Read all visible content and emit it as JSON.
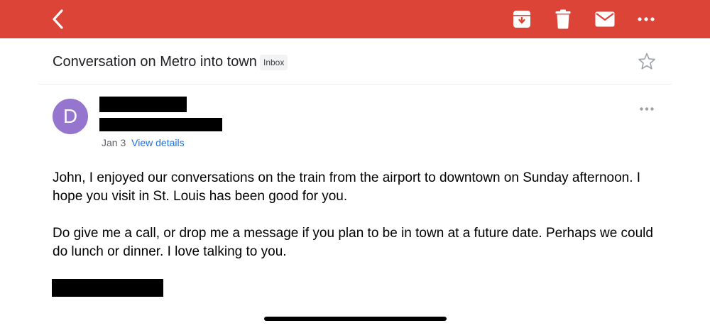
{
  "colors": {
    "accent": "#db4437",
    "avatar": "#9575cd",
    "link": "#1a73e8"
  },
  "toolbar": {
    "back_icon": "chevron-left-icon",
    "archive_icon": "archive-icon",
    "delete_icon": "trash-icon",
    "mark_unread_icon": "envelope-icon",
    "more_icon": "more-horizontal-icon"
  },
  "conversation": {
    "subject": "Conversation on Metro into town",
    "label": "Inbox",
    "star_icon": "star-outline-icon"
  },
  "message": {
    "avatar_letter": "D",
    "date": "Jan 3",
    "view_details": "View details",
    "paragraphs": [
      "John, I enjoyed our conversations on the train from the airport to downtown on Sunday afternoon.  I hope you visit in St. Louis has been good for you.",
      "Do give me a call, or drop me a message if you plan to be in town at a future date.  Perhaps we could do lunch or dinner.  I love talking to you."
    ]
  }
}
